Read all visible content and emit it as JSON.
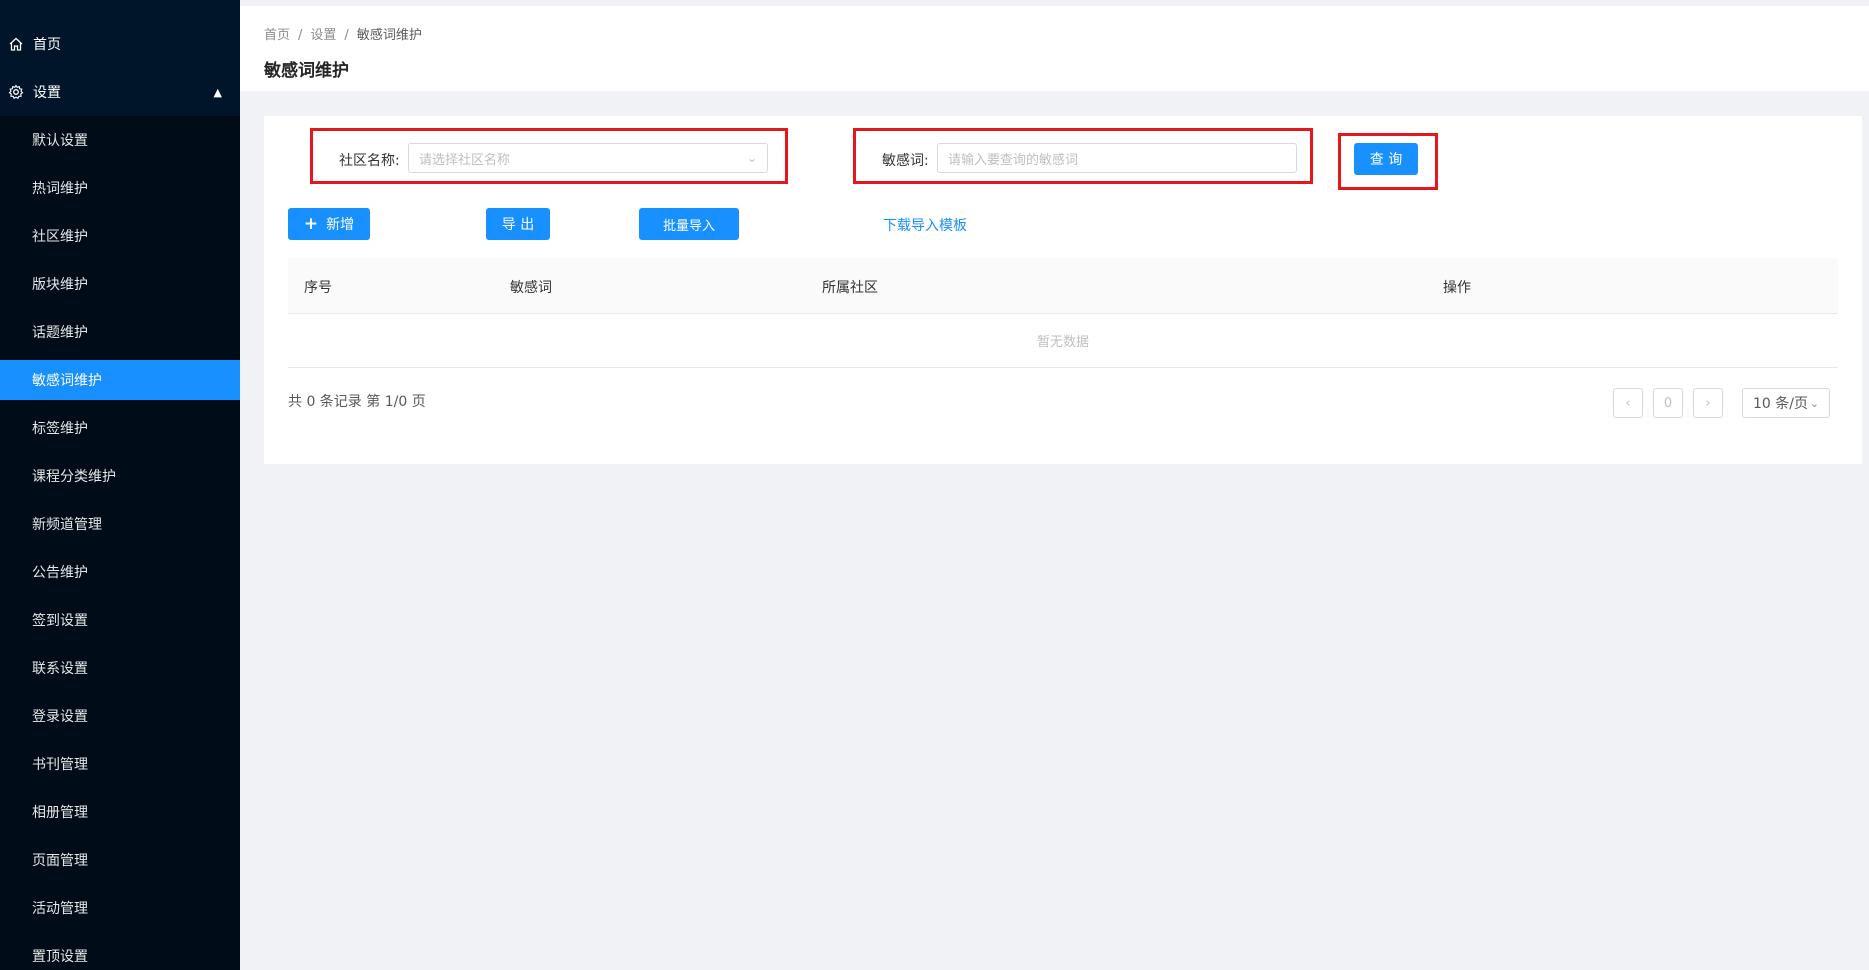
{
  "sidebar": {
    "home_label": "首页",
    "settings_label": "设置",
    "items": [
      {
        "label": "默认设置"
      },
      {
        "label": "热词维护"
      },
      {
        "label": "社区维护"
      },
      {
        "label": "版块维护"
      },
      {
        "label": "话题维护"
      },
      {
        "label": "敏感词维护"
      },
      {
        "label": "标签维护"
      },
      {
        "label": "课程分类维护"
      },
      {
        "label": "新频道管理"
      },
      {
        "label": "公告维护"
      },
      {
        "label": "签到设置"
      },
      {
        "label": "联系设置"
      },
      {
        "label": "登录设置"
      },
      {
        "label": "书刊管理"
      },
      {
        "label": "相册管理"
      },
      {
        "label": "页面管理"
      },
      {
        "label": "活动管理"
      },
      {
        "label": "置顶设置"
      }
    ],
    "active_index": 5
  },
  "breadcrumb": {
    "items": [
      "首页",
      "设置",
      "敏感词维护"
    ],
    "separator": "/"
  },
  "page_title": "敏感词维护",
  "filters": {
    "community_label": "社区名称:",
    "community_placeholder": "请选择社区名称",
    "word_label": "敏感词:",
    "word_placeholder": "请输入要查询的敏感词",
    "query_button": "查 询"
  },
  "toolbar": {
    "add_label": "新增",
    "add_icon": "plus-icon",
    "export_label": "导 出",
    "import_label": "批量导入",
    "download_label": "下载导入模板"
  },
  "table": {
    "columns": [
      "序号",
      "敏感词",
      "所属社区",
      "操作"
    ],
    "empty_text": "暂无数据"
  },
  "pagination": {
    "summary": "共 0 条记录 第 1/0 页",
    "current_page": "0",
    "page_size": "10 条/页"
  },
  "colors": {
    "sidebar_bg": "#001529",
    "accent": "#1890ff",
    "highlight_box": "#e3171c"
  }
}
